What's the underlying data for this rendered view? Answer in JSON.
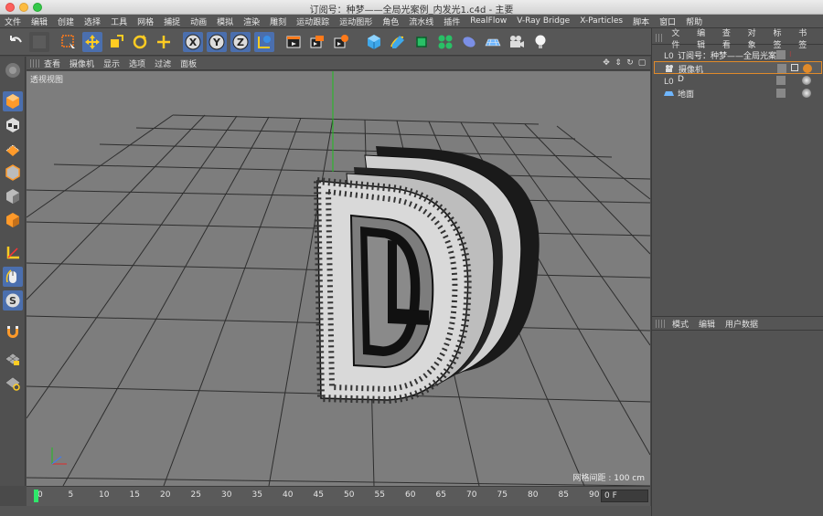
{
  "window": {
    "title": "订阅号：种梦——全局光案例_内发光1.c4d - 主要"
  },
  "menubar": {
    "items": [
      "文件",
      "编辑",
      "创建",
      "选择",
      "工具",
      "网格",
      "捕捉",
      "动画",
      "模拟",
      "渲染",
      "雕刻",
      "运动跟踪",
      "运动图形",
      "角色",
      "流水线",
      "插件",
      "RealFlow",
      "V-Ray Bridge",
      "X-Particles",
      "脚本",
      "窗口",
      "帮助"
    ]
  },
  "toolbar": {
    "icons": [
      "undo-icon",
      "redo-icon",
      "live-select-icon",
      "move-icon",
      "scale-icon",
      "rotate-icon",
      "recent-tool-icon",
      "x-axis-icon",
      "y-axis-icon",
      "z-axis-icon",
      "coordinate-system-icon",
      "render-view-icon",
      "render-picture-viewer-icon",
      "render-settings-icon",
      "cube-icon",
      "pen-spline-icon",
      "subdivision-icon",
      "cloner-icon",
      "deformer-icon",
      "floor-icon",
      "camera-icon",
      "light-icon"
    ],
    "axis_labels": {
      "x": "X",
      "y": "Y",
      "z": "Z"
    }
  },
  "left_tools": [
    "model-mode-icon",
    "object-mode-icon",
    "texture-mode-icon",
    "point-mode-icon",
    "edge-mode-icon",
    "polygon-mode-icon",
    "axis-mode-icon",
    "tweak-mode-icon",
    "snap-icon",
    "magnet-icon",
    "workplane-icon",
    "workplane-lock-icon"
  ],
  "viewport_menu": {
    "items": [
      "查看",
      "摄像机",
      "显示",
      "选项",
      "过滤",
      "面板"
    ]
  },
  "viewport": {
    "label": "透视视图",
    "grid_spacing": "网格间距 : 100 cm"
  },
  "timeline": {
    "ticks": [
      "0",
      "5",
      "10",
      "15",
      "20",
      "25",
      "30",
      "35",
      "40",
      "45",
      "50",
      "55",
      "60",
      "65",
      "70",
      "75",
      "80",
      "85",
      "90"
    ],
    "frame_field": "0 F",
    "current_frame": 0
  },
  "object_manager": {
    "tabs": [
      "文件",
      "编辑",
      "查看",
      "对象",
      "标签",
      "书签"
    ],
    "objects": [
      {
        "name": "订阅号：种梦——全局光案例",
        "type": "null"
      },
      {
        "name": "摄像机",
        "type": "camera",
        "selected": true
      },
      {
        "name": "D",
        "type": "null"
      },
      {
        "name": "地面",
        "type": "floor"
      }
    ]
  },
  "attribute_manager": {
    "tabs": [
      "模式",
      "编辑",
      "用户数据"
    ]
  },
  "colors": {
    "accent": "#4b6fae",
    "selection": "#e08a2a",
    "viewport_bg": "#7d7d7d"
  }
}
